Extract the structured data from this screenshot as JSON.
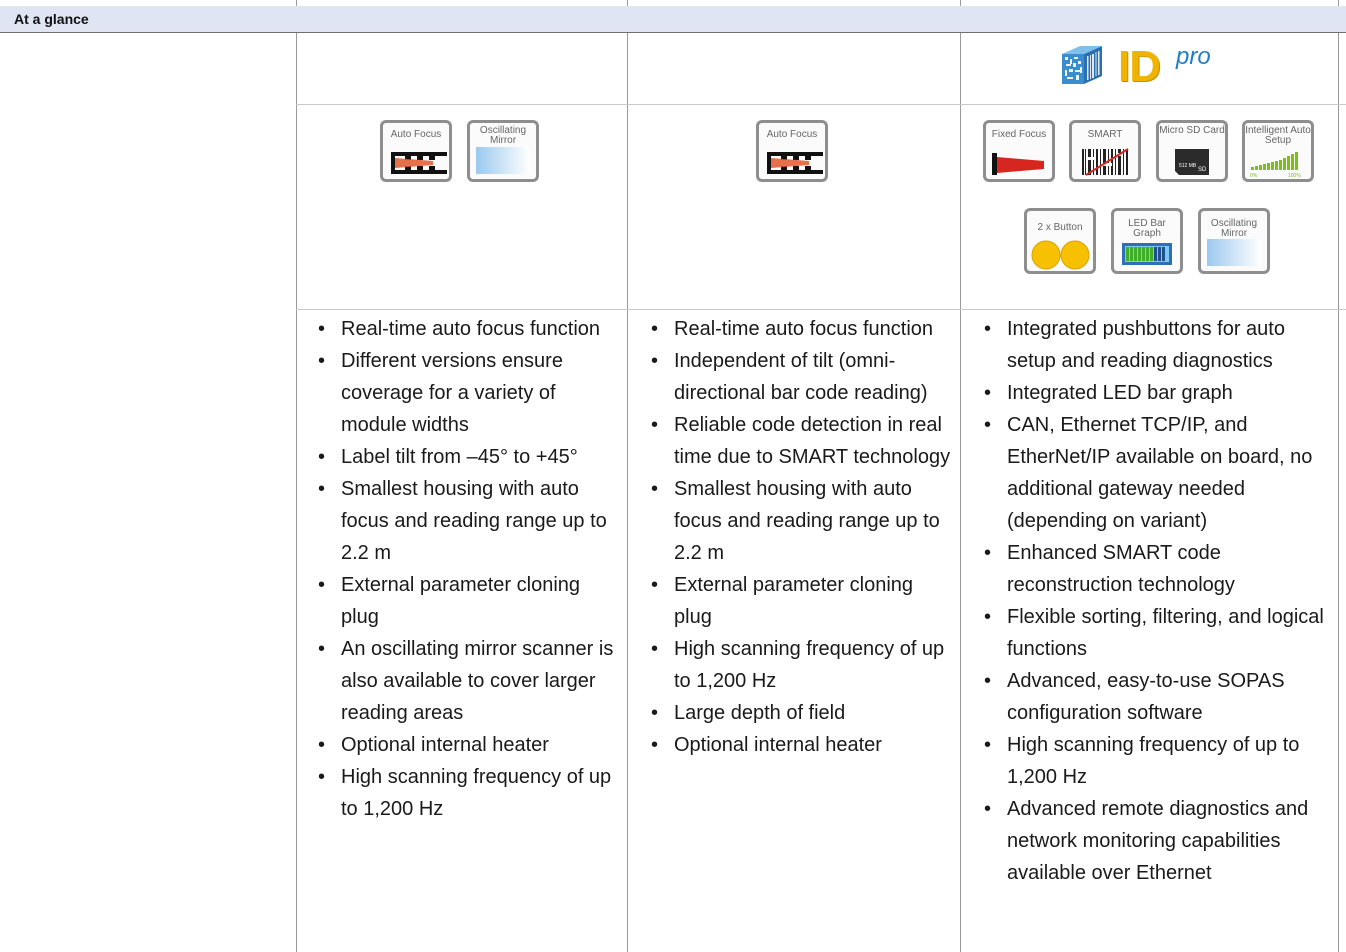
{
  "header": {
    "title": "At a glance"
  },
  "logo": {
    "letters": "ID",
    "suffix": "pro"
  },
  "columns": [
    {
      "icons": [
        {
          "name": "auto-focus-icon",
          "label": "Auto Focus"
        },
        {
          "name": "oscillating-mirror-icon",
          "label": "Oscillating Mirror"
        }
      ],
      "features": [
        "Real-time auto focus function",
        "Different versions ensure coverage for a variety of module widths",
        "Label tilt from –45° to +45°",
        "Smallest housing with auto focus and reading range up to 2.2 m",
        "External parameter cloning plug",
        "An oscillating mirror scanner is also available to cover larger reading areas",
        "Optional internal heater",
        "High scanning frequency of up to 1,200 Hz"
      ]
    },
    {
      "icons": [
        {
          "name": "auto-focus-icon",
          "label": "Auto Focus"
        }
      ],
      "features": [
        "Real-time auto focus function",
        "Independent of tilt (omni-directional bar code reading)",
        "Reliable code detection in real time due to SMART technology",
        "Smallest housing with auto focus and reading range up to 2.2 m",
        "External parameter cloning plug",
        "High scanning frequency of up to 1,200 Hz",
        "Large depth of field",
        "Optional internal heater"
      ]
    },
    {
      "icons": [
        {
          "name": "fixed-focus-icon",
          "label": "Fixed Focus"
        },
        {
          "name": "smart-icon",
          "label": "SMART"
        },
        {
          "name": "micro-sd-card-icon",
          "label": "Micro SD Card"
        },
        {
          "name": "intelligent-auto-setup-icon",
          "label": "Intelligent Auto Setup",
          "scale_min": "0%",
          "scale_max": "100%"
        },
        {
          "name": "two-button-icon",
          "label": "2 x Button"
        },
        {
          "name": "led-bar-graph-icon",
          "label": "LED Bar Graph"
        },
        {
          "name": "oscillating-mirror-icon",
          "label": "Oscillating Mirror"
        }
      ],
      "microsd": {
        "capacity": "512 MB",
        "brand": "SD"
      },
      "features": [
        "Integrated pushbuttons for auto setup and reading diagnostics",
        "Integrated LED bar graph",
        "CAN, Ethernet TCP/IP, and EtherNet/IP available on board, no additional gateway needed (depending on variant)",
        "Enhanced SMART code reconstruction technology",
        "Flexible sorting, filtering, and logical functions",
        "Advanced, easy-to-use SOPAS configuration software",
        "High scanning frequency of up to 1,200 Hz",
        "Advanced remote diagnostics and network monitoring capabilities available over Ethernet"
      ]
    }
  ],
  "colors": {
    "header_bg": "#dfe5f2",
    "logo_yellow": "#f0b400",
    "logo_blue": "#1e7fc8",
    "tile_border": "#8e8e8e"
  }
}
